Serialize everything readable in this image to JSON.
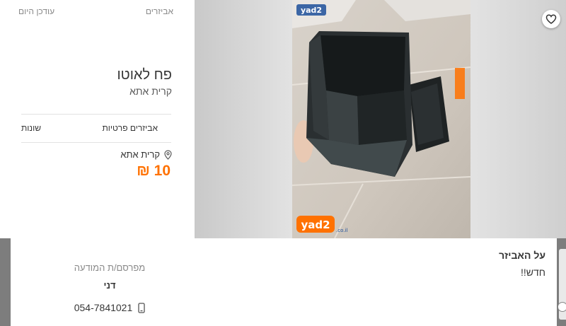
{
  "listing": {
    "category_link": "אביזרים",
    "updated": "עודכן היום",
    "title": "פח לאוטו",
    "subtitle": "קרית אתא",
    "categories": [
      "אביזרים פרטיות",
      "שונות"
    ],
    "location": "קרית אתא",
    "price": "10 ₪"
  },
  "gallery": {
    "brand_top": "yad2",
    "brand_bottom": "yad2",
    "brand_suffix": ".co.il"
  },
  "about": {
    "heading": "על האביזר",
    "description": "חדש!!"
  },
  "advertiser": {
    "label": "מפרסם/ת המודעה",
    "name": "דני",
    "phone": "054-7841021"
  },
  "colors": {
    "price": "#ff7100",
    "brand": "#ff7100",
    "text": "#363636",
    "muted": "#8a8a8a"
  },
  "icons": [
    "heart-icon",
    "location-pin-icon",
    "phone-icon"
  ]
}
